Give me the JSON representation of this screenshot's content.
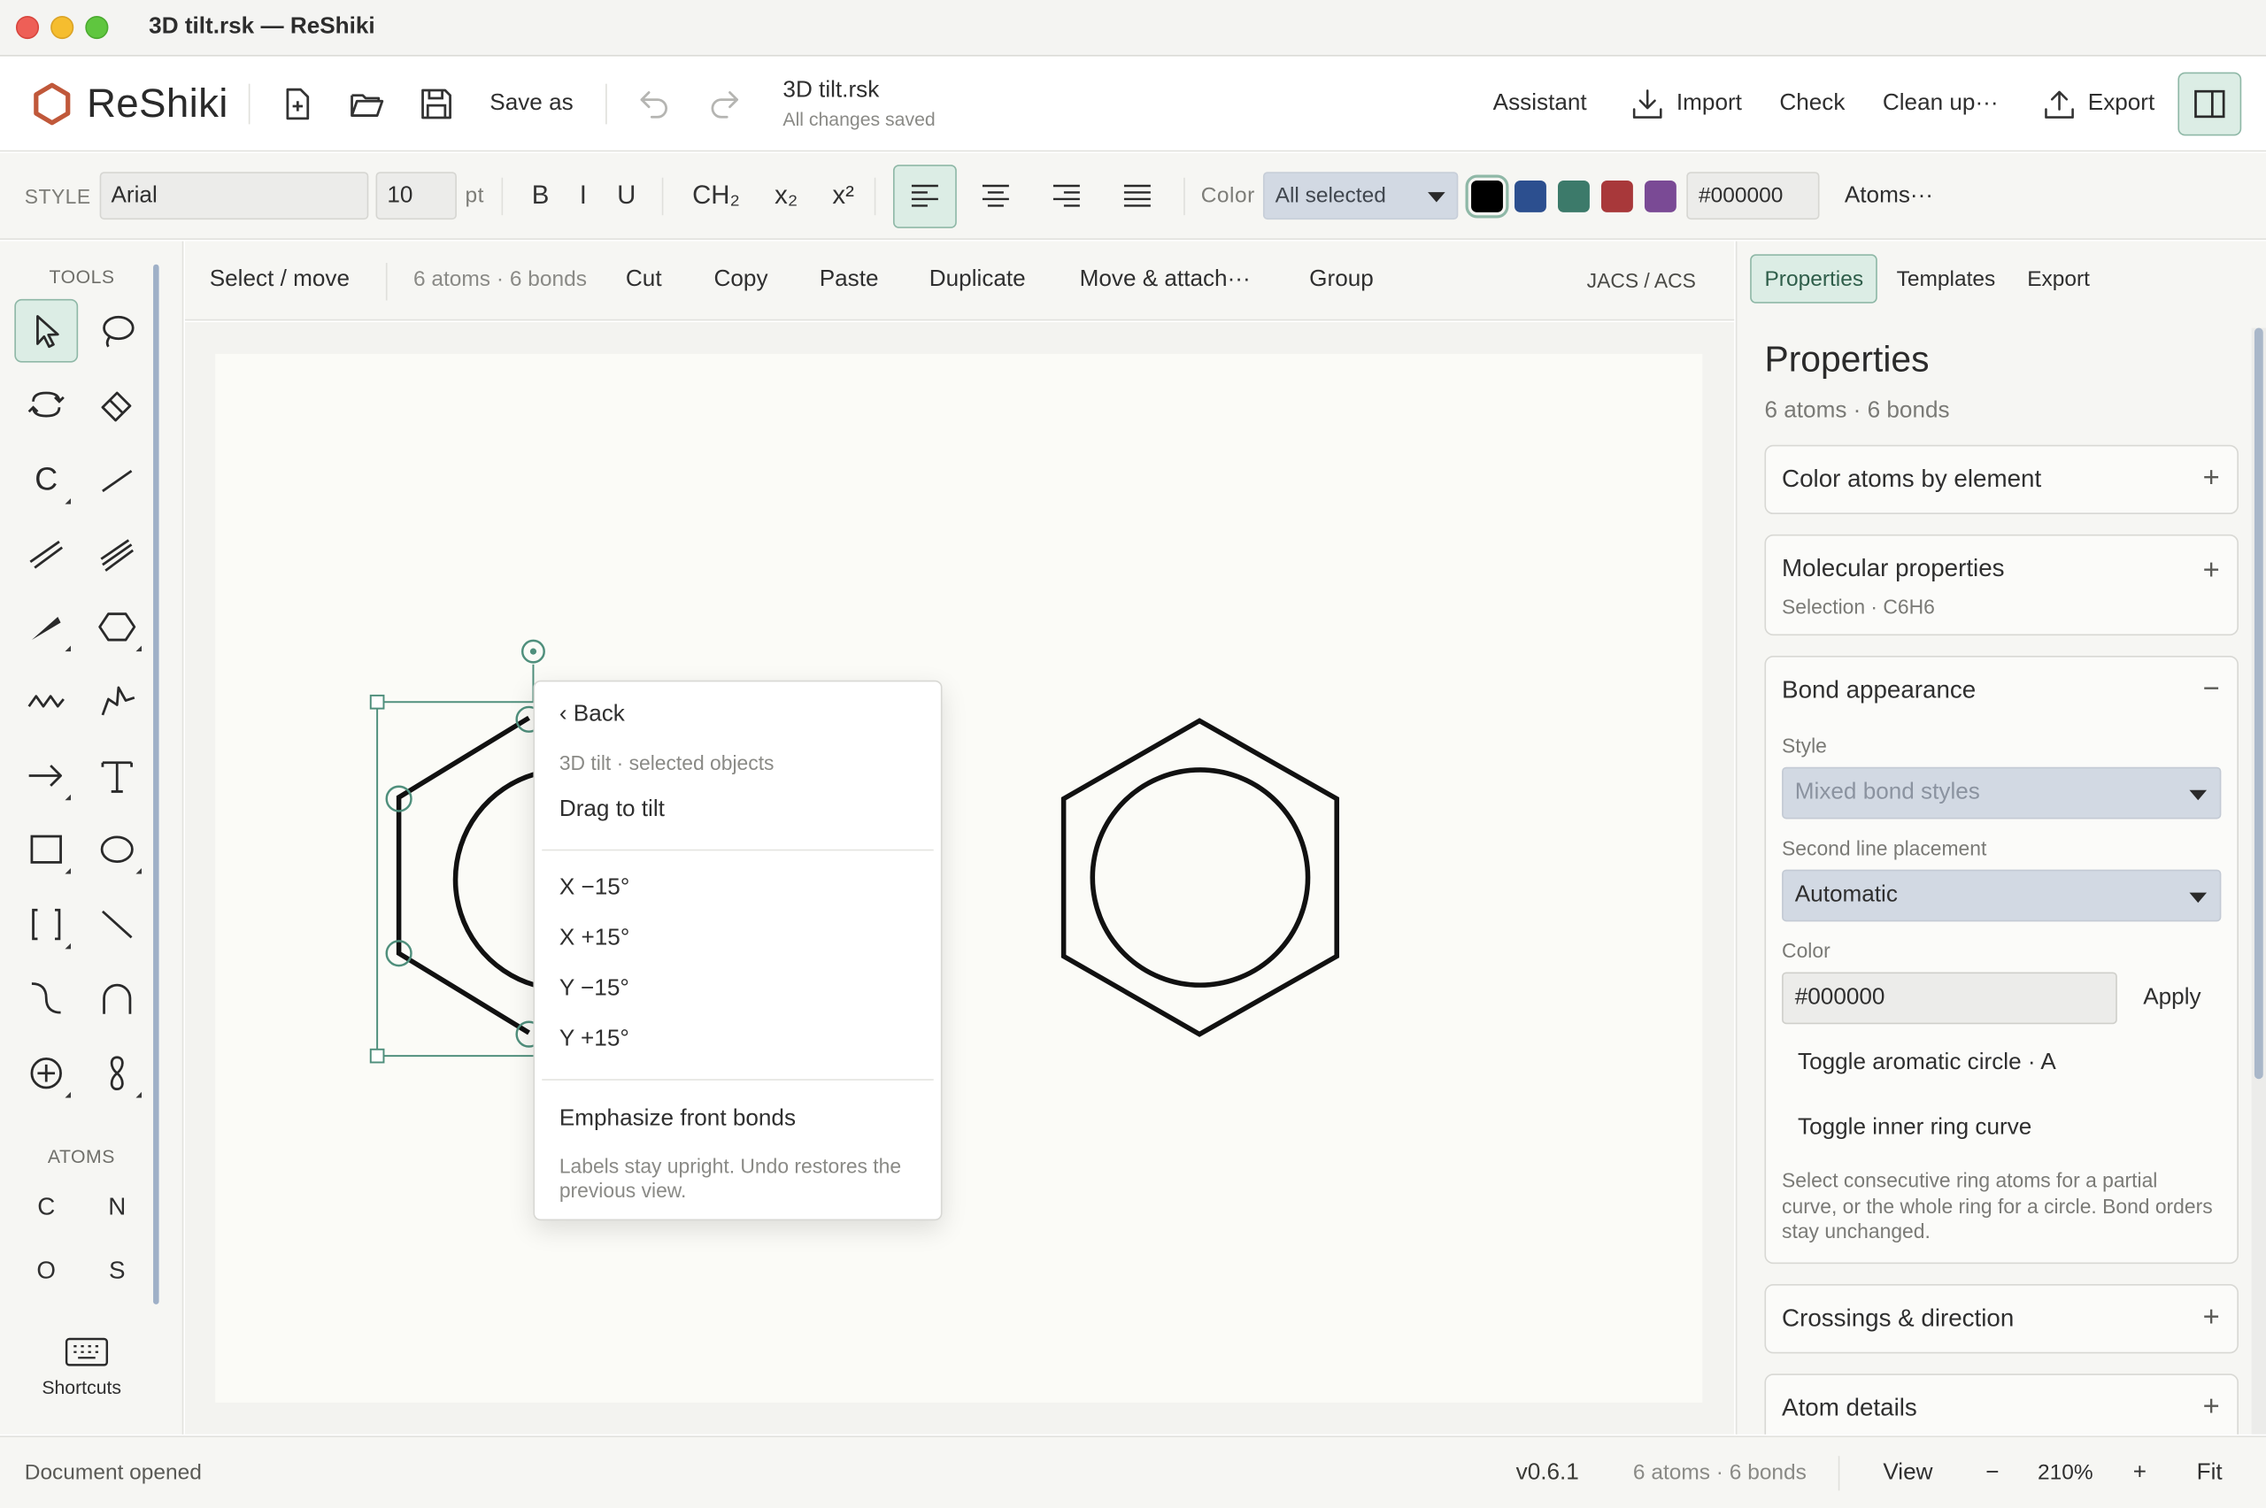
{
  "window": {
    "title": "3D tilt.rsk — ReShiki"
  },
  "app": {
    "name": "ReShiki",
    "brand_color": "#c0583a",
    "accent": "#3c8a6f"
  },
  "toolbar": {
    "new_icon": "new-file-icon",
    "open_icon": "open-folder-icon",
    "save_icon": "save-icon",
    "save_as_label": "Save as",
    "undo_icon": "undo-icon",
    "redo_icon": "redo-icon",
    "doc_name": "3D tilt.rsk",
    "doc_status": "All changes saved",
    "assistant_label": "Assistant",
    "import_label": "Import",
    "check_label": "Check",
    "cleanup_label": "Clean up···",
    "export_label": "Export"
  },
  "format": {
    "style_label": "STYLE",
    "font": "Arial",
    "size": "10",
    "size_unit": "pt",
    "bold": "B",
    "italic": "I",
    "underline": "U",
    "ch2": "CH₂",
    "sub": "x₂",
    "sup": "x²",
    "color_label": "Color",
    "color_target": "All selected",
    "swatches": [
      "#000000",
      "#2c4f8f",
      "#3c7a6a",
      "#a8383a",
      "#7a4a95"
    ],
    "hex": "#000000",
    "atoms_label": "Atoms···"
  },
  "tools": {
    "header": "TOOLS",
    "atoms_header": "ATOMS",
    "atoms": [
      "C",
      "N",
      "O",
      "S"
    ],
    "shortcuts_label": "Shortcuts",
    "carbon_label": "C"
  },
  "editbar": {
    "mode": "Select / move",
    "count": "6 atoms · 6 bonds",
    "cut": "Cut",
    "copy": "Copy",
    "paste": "Paste",
    "duplicate": "Duplicate",
    "move_attach": "Move & attach···",
    "group": "Group",
    "style_preset": "JACS / ACS"
  },
  "context_menu": {
    "back": "‹ Back",
    "subtitle": "3D tilt · selected objects",
    "drag": "Drag to tilt",
    "items": [
      "X −15°",
      "X +15°",
      "Y −15°",
      "Y +15°"
    ],
    "emphasize": "Emphasize front bonds",
    "note": "Labels stay upright. Undo restores the previous view."
  },
  "panel": {
    "tabs": [
      "Properties",
      "Templates",
      "Export"
    ],
    "title": "Properties",
    "summary": "6 atoms · 6 bonds",
    "color_atoms": "Color atoms by element",
    "molecular": "Molecular properties",
    "molecular_sub": "Selection · C6H6",
    "bond_appearance": "Bond appearance",
    "style_label": "Style",
    "style_value": "Mixed bond styles",
    "second_line_label": "Second line placement",
    "second_line_value": "Automatic",
    "color_label": "Color",
    "color_value": "#000000",
    "apply": "Apply",
    "toggle_aromatic": "Toggle aromatic circle · A",
    "toggle_inner": "Toggle inner ring curve",
    "help": "Select consecutive ring atoms for a partial curve, or the whole ring for a circle. Bond orders stay unchanged.",
    "crossings": "Crossings & direction",
    "atom_details": "Atom details",
    "plus": "+",
    "minus": "−"
  },
  "status": {
    "message": "Document opened",
    "version": "v0.6.1",
    "count": "6 atoms · 6 bonds",
    "view": "View",
    "zoom_out": "−",
    "zoom": "210%",
    "zoom_in": "+",
    "fit": "Fit"
  }
}
